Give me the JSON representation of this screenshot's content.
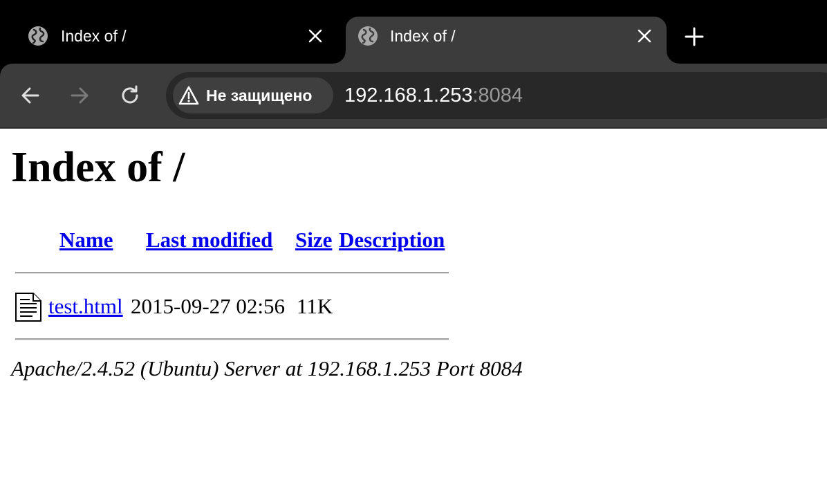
{
  "browser": {
    "tabs": [
      {
        "title": "Index of /",
        "active": false,
        "favicon": "globe-icon"
      },
      {
        "title": "Index of /",
        "active": true,
        "favicon": "globe-icon"
      }
    ],
    "new_tab_icon": "plus-icon",
    "security_label": "Не защищено",
    "url": {
      "host": "192.168.1.253",
      "port": ":8084"
    }
  },
  "page": {
    "heading": "Index of /",
    "columns": [
      "Name",
      "Last modified",
      "Size",
      "Description"
    ],
    "rows": [
      {
        "icon": "text-file-icon",
        "name": "test.html",
        "modified": "2015-09-27 02:56",
        "size": "11K",
        "description": ""
      }
    ],
    "footer": "Apache/2.4.52 (Ubuntu) Server at 192.168.1.253 Port 8084"
  },
  "colors": {
    "tabstrip": "#000000",
    "toolbar": "#3c3c3c",
    "omnibox": "#282828",
    "link": "#0000ee"
  }
}
